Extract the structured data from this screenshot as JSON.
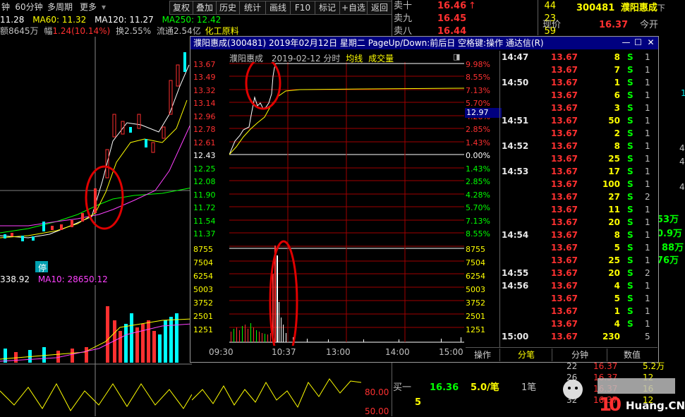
{
  "toolbar": {
    "left_items": [
      "钟",
      "60分钟",
      "多周期",
      "更多"
    ],
    "buttons": [
      "复权",
      "叠加",
      "历史",
      "统计",
      "画线",
      "F10",
      "标记",
      "+自选",
      "返回"
    ]
  },
  "indicator_row1": {
    "ma_current": "11.28",
    "ma60": "MA60: 11.32",
    "ma120": "MA120: 11.27",
    "ma250": "MA250: 12.42"
  },
  "indicator_row2": {
    "amount": "额8645万",
    "change_label": "幅",
    "change_value": "1.24(10.14%)",
    "turnover": "换2.55%",
    "float_cap": "流通2.54亿",
    "industry": "化工原料"
  },
  "lower_indicator": {
    "vol_value": "338.92",
    "ma10": "MA10: 28650.12",
    "stop_badge": "停"
  },
  "order_book_top": [
    {
      "label": "卖十",
      "price": "16.46",
      "arrow": "↑",
      "volume": "44"
    },
    {
      "label": "卖九",
      "price": "16.45",
      "volume": "23"
    },
    {
      "label": "卖八",
      "price": "16.44",
      "volume": "59"
    }
  ],
  "stock_header": {
    "code": "300481",
    "name": "濮阳惠成",
    "suffix": "下",
    "current_label": "现价",
    "current_value": "16.37",
    "open_label": "今开"
  },
  "right_partial_values": [
    "1",
    "4",
    "4",
    "4",
    "53万",
    "0.9万",
    "88万",
    "76万"
  ],
  "bottom_quote": {
    "buy1_label": "买一",
    "buy1_price": "16.36",
    "buy1_vol": "5.0/笔",
    "buy1_count": "1笔",
    "sub_value": "5",
    "osc_labels": [
      "80.00",
      "50.00"
    ],
    "trade_rows": [
      {
        "qty": "22",
        "price": "16.37",
        "vol": "5.2万"
      },
      {
        "qty": "26",
        "price": "16.37",
        "vol": "12"
      },
      {
        "qty": "29",
        "price": "16.37",
        "vol": "16"
      },
      {
        "qty": "32",
        "price": "16.37",
        "vol": "12"
      }
    ]
  },
  "watermark": {
    "text": "Huang.CN"
  },
  "popup": {
    "title": "濮阳惠成(300481) 2019年02月12日 星期二 PageUp/Down:前后日 空格键:操作 通达信(R)",
    "chart_name": "濮阳惠成",
    "chart_date": "2019-02-12",
    "chart_kind": "分时",
    "avg_label": "均线",
    "vol_label": "成交量",
    "price_marker": "12.97",
    "tabs": [
      "操作",
      "分笔",
      "分钟",
      "数值"
    ],
    "price_axis_left": [
      "13.67",
      "13.49",
      "13.32",
      "13.14",
      "12.96",
      "12.78",
      "12.61",
      "12.43",
      "12.25",
      "12.08",
      "11.90",
      "11.72",
      "11.54",
      "11.37"
    ],
    "pct_axis_right": [
      "9.98%",
      "8.55%",
      "7.13%",
      "5.70%",
      "4.28%",
      "2.85%",
      "1.43%",
      "0.00%",
      "1.43%",
      "2.85%",
      "4.28%",
      "5.70%",
      "7.13%",
      "8.55%"
    ],
    "vol_axis": [
      "8755",
      "7504",
      "6254",
      "5003",
      "3752",
      "2501",
      "1251"
    ],
    "time_axis": [
      "09:30",
      "10:37",
      "13:00",
      "14:00",
      "15:00"
    ],
    "ticks": [
      {
        "time": "14:47",
        "price": "13.67",
        "vol": "8",
        "bs": "S",
        "cnt": "1"
      },
      {
        "time": "",
        "price": "13.67",
        "vol": "7",
        "bs": "S",
        "cnt": "1"
      },
      {
        "time": "14:50",
        "price": "13.67",
        "vol": "1",
        "bs": "S",
        "cnt": "1"
      },
      {
        "time": "",
        "price": "13.67",
        "vol": "6",
        "bs": "S",
        "cnt": "1"
      },
      {
        "time": "",
        "price": "13.67",
        "vol": "3",
        "bs": "S",
        "cnt": "1"
      },
      {
        "time": "14:51",
        "price": "13.67",
        "vol": "50",
        "bs": "S",
        "cnt": "1"
      },
      {
        "time": "",
        "price": "13.67",
        "vol": "2",
        "bs": "S",
        "cnt": "1"
      },
      {
        "time": "14:52",
        "price": "13.67",
        "vol": "8",
        "bs": "S",
        "cnt": "1"
      },
      {
        "time": "",
        "price": "13.67",
        "vol": "25",
        "bs": "S",
        "cnt": "1"
      },
      {
        "time": "14:53",
        "price": "13.67",
        "vol": "17",
        "bs": "S",
        "cnt": "1"
      },
      {
        "time": "",
        "price": "13.67",
        "vol": "100",
        "bs": "S",
        "cnt": "1"
      },
      {
        "time": "",
        "price": "13.67",
        "vol": "27",
        "bs": "S",
        "cnt": "2"
      },
      {
        "time": "",
        "price": "13.67",
        "vol": "11",
        "bs": "S",
        "cnt": "1"
      },
      {
        "time": "",
        "price": "13.67",
        "vol": "20",
        "bs": "S",
        "cnt": "1"
      },
      {
        "time": "14:54",
        "price": "13.67",
        "vol": "8",
        "bs": "S",
        "cnt": "1"
      },
      {
        "time": "",
        "price": "13.67",
        "vol": "5",
        "bs": "S",
        "cnt": "1"
      },
      {
        "time": "",
        "price": "13.67",
        "vol": "25",
        "bs": "S",
        "cnt": "1"
      },
      {
        "time": "14:55",
        "price": "13.67",
        "vol": "20",
        "bs": "S",
        "cnt": "2"
      },
      {
        "time": "14:56",
        "price": "13.67",
        "vol": "4",
        "bs": "S",
        "cnt": "1"
      },
      {
        "time": "",
        "price": "13.67",
        "vol": "5",
        "bs": "S",
        "cnt": "1"
      },
      {
        "time": "",
        "price": "13.67",
        "vol": "1",
        "bs": "S",
        "cnt": "1"
      },
      {
        "time": "",
        "price": "13.67",
        "vol": "4",
        "bs": "S",
        "cnt": "1"
      },
      {
        "time": "15:00",
        "price": "13.67",
        "vol": "230",
        "bs": "",
        "cnt": "5"
      }
    ]
  },
  "colors": {
    "up": "#ff3030",
    "down": "#00ff00",
    "title_bg": "#000080",
    "annotation": "#e00000"
  }
}
